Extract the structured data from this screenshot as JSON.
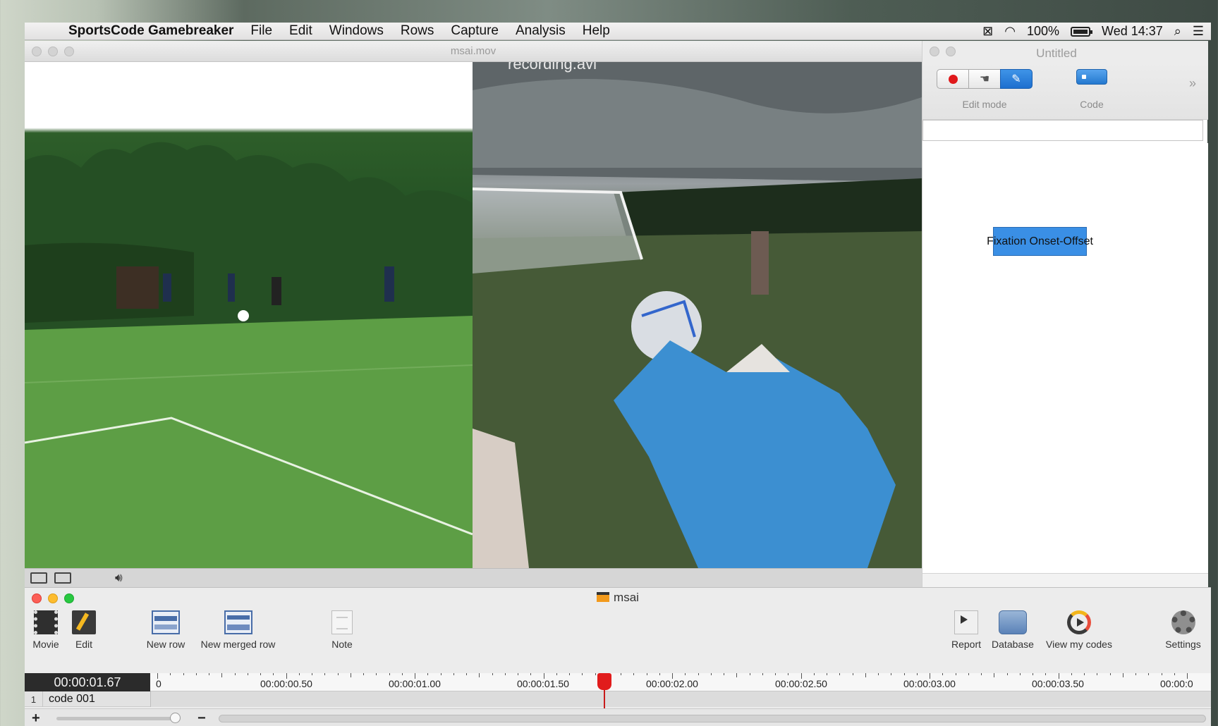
{
  "menubar": {
    "app_name": "SportsCode Gamebreaker",
    "items": [
      "File",
      "Edit",
      "Windows",
      "Rows",
      "Capture",
      "Analysis",
      "Help"
    ],
    "battery": "100%",
    "clock": "Wed 14:37"
  },
  "movie_window": {
    "title": "msai.mov",
    "overlay_text": "recording.avi"
  },
  "code_window": {
    "title": "Untitled",
    "edit_mode_label": "Edit mode",
    "code_label": "Code",
    "code_button_label": "Fixation Onset-Offset"
  },
  "timeline_window": {
    "title": "msai",
    "toolbar": {
      "movie": "Movie",
      "edit": "Edit",
      "new_row": "New row",
      "new_merged_row": "New merged row",
      "note": "Note",
      "report": "Report",
      "database": "Database",
      "view_my_codes": "View my codes",
      "settings": "Settings"
    },
    "current_time": "00:00:01.67",
    "ruler": [
      "0",
      "00:00:00.50",
      "00:00:01.00",
      "00:00:01.50",
      "00:00:02.00",
      "00:00:02.50",
      "00:00:03.00",
      "00:00:03.50",
      "00:00:0"
    ],
    "playhead_time_seconds": 1.67,
    "rows": [
      {
        "number": "1",
        "name": "code 001"
      }
    ]
  },
  "colors": {
    "accent_blue": "#3a8fe5",
    "record_red": "#e0191b",
    "playhead_red": "#e11c1c"
  }
}
